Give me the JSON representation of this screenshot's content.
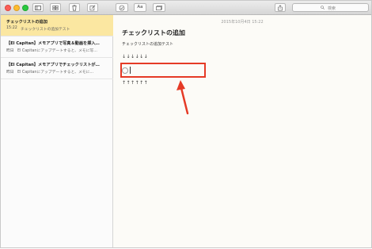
{
  "toolbar": {
    "search_placeholder": "検索",
    "font_button_label": "Aa"
  },
  "notes_list": [
    {
      "title": "チェックリストの追加",
      "date": "15:22",
      "preview": "チェックリストの追加テスト"
    },
    {
      "title": "【El Capitan】メモアプリで写真＆動画を挿入…",
      "date": "昨日",
      "preview": "El Capitanにアップデートすると、メモに写…"
    },
    {
      "title": "【El Capitan】メモアプリでチェックリストが…",
      "date": "昨日",
      "preview": "El Capitanにアップデートすると、メモに…"
    }
  ],
  "editor": {
    "timestamp": "2015年10月4日 15:22",
    "heading": "チェックリストの追加",
    "body_line": "チェックリストの追加テスト",
    "down_arrows": "↓↓↓↓↓↓",
    "checklist_item_text": "",
    "up_arrows": "↑↑↑↑↑↑"
  },
  "colors": {
    "highlight_box": "#e53a26",
    "selected_note": "#fbe7a1"
  }
}
